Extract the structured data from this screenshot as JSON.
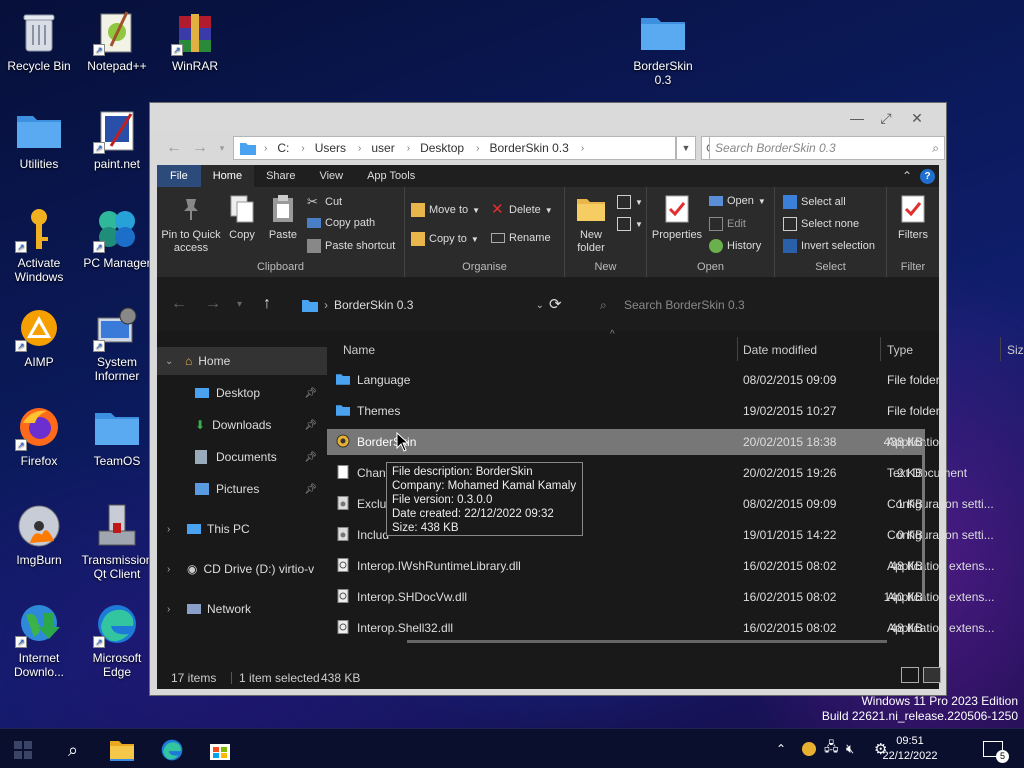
{
  "desktop": {
    "icons": [
      {
        "label": "Recycle Bin"
      },
      {
        "label": "Notepad++"
      },
      {
        "label": "WinRAR"
      },
      {
        "label": "BorderSkin 0.3"
      },
      {
        "label": "Utilities"
      },
      {
        "label": "paint.net"
      },
      {
        "label": "Activate Windows"
      },
      {
        "label": "PC Manager"
      },
      {
        "label": "AIMP"
      },
      {
        "label": "System Informer"
      },
      {
        "label": "Firefox"
      },
      {
        "label": "TeamOS"
      },
      {
        "label": "ImgBurn"
      },
      {
        "label": "Transmission Qt Client"
      },
      {
        "label": "Internet Downlo..."
      },
      {
        "label": "Microsoft Edge"
      }
    ]
  },
  "window": {
    "address": {
      "segments": [
        "C:",
        "Users",
        "user",
        "Desktop",
        "BorderSkin 0.3"
      ],
      "search_placeholder": "Search BorderSkin 0.3"
    },
    "ribbon_tabs": [
      "File",
      "Home",
      "Share",
      "View",
      "App Tools"
    ],
    "ribbon": {
      "clipboard": {
        "pin": "Pin to Quick access",
        "copy": "Copy",
        "paste": "Paste",
        "cut": "Cut",
        "copy_path": "Copy path",
        "paste_shortcut": "Paste shortcut",
        "group": "Clipboard"
      },
      "organise": {
        "move_to": "Move to",
        "copy_to": "Copy to",
        "delete": "Delete",
        "rename": "Rename",
        "group": "Organise"
      },
      "new": {
        "new_folder": "New folder",
        "group": "New"
      },
      "open": {
        "properties": "Properties",
        "open": "Open",
        "edit": "Edit",
        "history": "History",
        "group": "Open"
      },
      "select": {
        "select_all": "Select all",
        "select_none": "Select none",
        "invert": "Invert selection",
        "group": "Select"
      },
      "filter": {
        "filters": "Filters",
        "group": "Filter"
      }
    },
    "nav2": {
      "path": "BorderSkin 0.3",
      "search_placeholder": "Search BorderSkin 0.3"
    },
    "navpane": {
      "home": "Home",
      "quick": [
        "Desktop",
        "Downloads",
        "Documents",
        "Pictures"
      ],
      "this_pc": "This PC",
      "cd_drive": "CD Drive (D:) virtio-v",
      "network": "Network"
    },
    "columns": {
      "name": "Name",
      "date": "Date modified",
      "type": "Type",
      "size": "Size"
    },
    "files": [
      {
        "name": "Language",
        "date": "08/02/2015 09:09",
        "type": "File folder",
        "size": ""
      },
      {
        "name": "Themes",
        "date": "19/02/2015 10:27",
        "type": "File folder",
        "size": ""
      },
      {
        "name": "BorderSkin",
        "date": "20/02/2015 18:38",
        "type": "Application",
        "size": "438 KB"
      },
      {
        "name": "Chang",
        "date": "20/02/2015 19:26",
        "type": "Text Document",
        "size": "2 KB"
      },
      {
        "name": "Exclu",
        "date": "08/02/2015 09:09",
        "type": "Configuration setti...",
        "size": "1 KB"
      },
      {
        "name": "Includ",
        "date": "19/01/2015 14:22",
        "type": "Configuration setti...",
        "size": "0 KB"
      },
      {
        "name": "Interop.IWshRuntimeLibrary.dll",
        "date": "16/02/2015 08:02",
        "type": "Application extens...",
        "size": "48 KB"
      },
      {
        "name": "Interop.SHDocVw.dll",
        "date": "16/02/2015 08:02",
        "type": "Application extens...",
        "size": "140 KB"
      },
      {
        "name": "Interop.Shell32.dll",
        "date": "16/02/2015 08:02",
        "type": "Application extens...",
        "size": "48 KB"
      }
    ],
    "status": {
      "items": "17 items",
      "selected": "1 item selected",
      "size": "438 KB"
    },
    "tooltip": [
      "File description: BorderSkin",
      "Company: Mohamed Kamal Kamaly",
      "File version: 0.3.0.0",
      "Date created: 22/12/2022 09:32",
      "Size: 438 KB"
    ]
  },
  "watermark": {
    "line1": "Windows 11 Pro 2023 Edition",
    "line2": "Build 22621.ni_release.220506-1250"
  },
  "taskbar": {
    "time": "09:51",
    "date": "22/12/2022",
    "notif_count": "5"
  },
  "colors": {
    "accent": "#1f6fd0",
    "folder": "#4aa3f0",
    "window_dark": "#191919",
    "ribbon": "#2b2b2b"
  }
}
